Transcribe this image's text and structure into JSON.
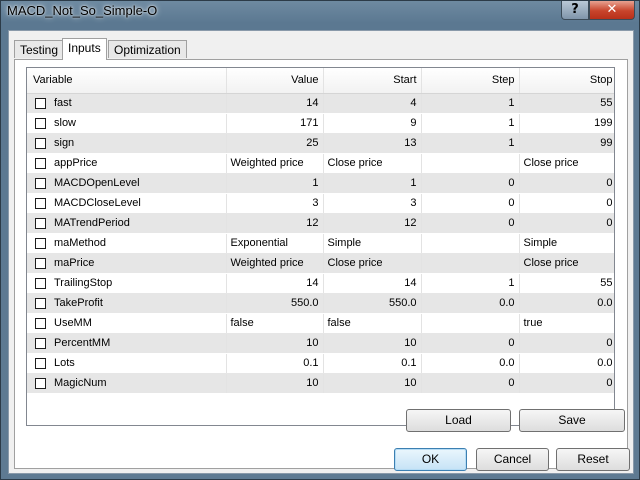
{
  "window": {
    "title": "MACD_Not_So_Simple-O",
    "help_label": "?",
    "close_label": "✕"
  },
  "tabs": [
    {
      "label": "Testing",
      "active": false
    },
    {
      "label": "Inputs",
      "active": true
    },
    {
      "label": "Optimization",
      "active": false
    }
  ],
  "table": {
    "columns": [
      "Variable",
      "Value",
      "Start",
      "Step",
      "Stop"
    ],
    "rows": [
      {
        "variable": "fast",
        "value": "14",
        "start": "4",
        "step": "1",
        "stop": "55",
        "checked": false
      },
      {
        "variable": "slow",
        "value": "171",
        "start": "9",
        "step": "1",
        "stop": "199",
        "checked": false
      },
      {
        "variable": "sign",
        "value": "25",
        "start": "13",
        "step": "1",
        "stop": "99",
        "checked": false
      },
      {
        "variable": "appPrice",
        "value": "Weighted price",
        "start": "Close price",
        "step": "",
        "stop": "Close price",
        "checked": false,
        "text": true
      },
      {
        "variable": "MACDOpenLevel",
        "value": "1",
        "start": "1",
        "step": "0",
        "stop": "0",
        "checked": false
      },
      {
        "variable": "MACDCloseLevel",
        "value": "3",
        "start": "3",
        "step": "0",
        "stop": "0",
        "checked": false
      },
      {
        "variable": "MATrendPeriod",
        "value": "12",
        "start": "12",
        "step": "0",
        "stop": "0",
        "checked": false
      },
      {
        "variable": "maMethod",
        "value": "Exponential",
        "start": "Simple",
        "step": "",
        "stop": "Simple",
        "checked": false,
        "text": true
      },
      {
        "variable": "maPrice",
        "value": "Weighted price",
        "start": "Close price",
        "step": "",
        "stop": "Close price",
        "checked": false,
        "text": true
      },
      {
        "variable": "TrailingStop",
        "value": "14",
        "start": "14",
        "step": "1",
        "stop": "55",
        "checked": false
      },
      {
        "variable": "TakeProfit",
        "value": "550.0",
        "start": "550.0",
        "step": "0.0",
        "stop": "0.0",
        "checked": false
      },
      {
        "variable": "UseMM",
        "value": "false",
        "start": "false",
        "step": "",
        "stop": "true",
        "checked": false,
        "text": true
      },
      {
        "variable": "PercentMM",
        "value": "10",
        "start": "10",
        "step": "0",
        "stop": "0",
        "checked": false
      },
      {
        "variable": "Lots",
        "value": "0.1",
        "start": "0.1",
        "step": "0.0",
        "stop": "0.0",
        "checked": false
      },
      {
        "variable": "MagicNum",
        "value": "10",
        "start": "10",
        "step": "0",
        "stop": "0",
        "checked": false
      }
    ]
  },
  "buttons": {
    "load": "Load",
    "save": "Save",
    "ok": "OK",
    "cancel": "Cancel",
    "reset": "Reset"
  }
}
